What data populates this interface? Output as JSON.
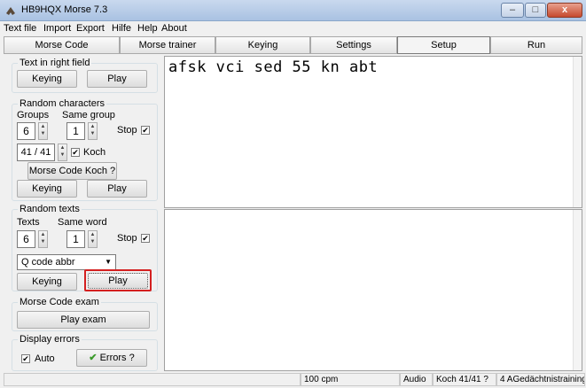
{
  "window": {
    "title": "HB9HQX Morse 7.3",
    "minimize": "–",
    "maximize": "□",
    "close": "x"
  },
  "menu": [
    "Text file",
    "Import",
    "Export",
    "Hilfe",
    "Help",
    "About"
  ],
  "tabs": [
    "Morse Code",
    "Morse trainer",
    "Keying",
    "Settings",
    "Setup",
    "Run"
  ],
  "text_in_right_field": {
    "title": "Text in right field",
    "keying": "Keying",
    "play": "Play"
  },
  "random_characters": {
    "title": "Random characters",
    "groups_label": "Groups",
    "same_group_label": "Same group",
    "groups_value": "6",
    "same_group_value": "1",
    "stop_label": "Stop",
    "stop_checked": "✔",
    "koch_value": "41 / 41",
    "koch_label": "Koch",
    "koch_checked": "✔",
    "koch_button": "Morse Code Koch ?",
    "keying": "Keying",
    "play": "Play"
  },
  "random_texts": {
    "title": "Random texts",
    "texts_label": "Texts",
    "same_word_label": "Same word",
    "texts_value": "6",
    "same_word_value": "1",
    "stop_label": "Stop",
    "stop_checked": "✔",
    "dropdown_value": "Q code abbr",
    "keying": "Keying",
    "play": "Play"
  },
  "morse_exam": {
    "title": "Morse Code exam",
    "play_exam": "Play exam"
  },
  "display_errors": {
    "title": "Display errors",
    "auto_label": "Auto",
    "auto_checked": "✔",
    "errors_button": "Errors ?"
  },
  "text_top": "afsk vci sed 55 kn abt",
  "statusbar": {
    "cpm": "100 cpm",
    "audio": "Audio",
    "koch": "Koch 41/41 ?",
    "training": "4 AGedächtnistraining"
  }
}
